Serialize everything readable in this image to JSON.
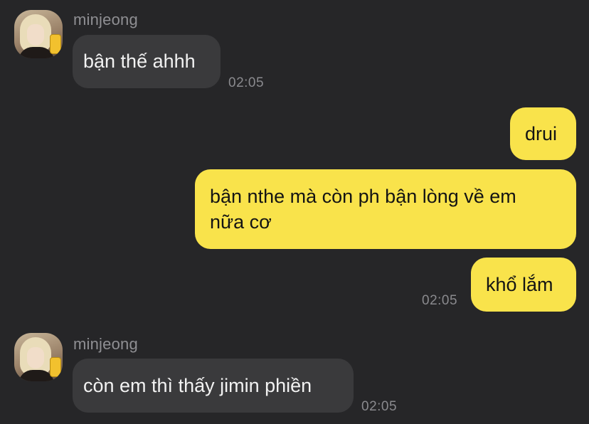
{
  "messages": [
    {
      "type": "incoming",
      "sender": "minjeong",
      "text": "bận thế ahhh",
      "time": "02:05"
    },
    {
      "type": "outgoing",
      "text": "drui"
    },
    {
      "type": "outgoing",
      "text": "bận nthe mà còn ph bận lòng về em\nnữa cơ"
    },
    {
      "type": "outgoing",
      "text": "khổ lắm",
      "time": "02:05"
    },
    {
      "type": "incoming",
      "sender": "minjeong",
      "text": "còn em thì thấy jimin phiền",
      "time": "02:05"
    }
  ],
  "colors": {
    "background": "#262628",
    "incoming_bubble": "#3a3a3c",
    "outgoing_bubble": "#f9e34b",
    "timestamp": "#8a8a8e"
  }
}
